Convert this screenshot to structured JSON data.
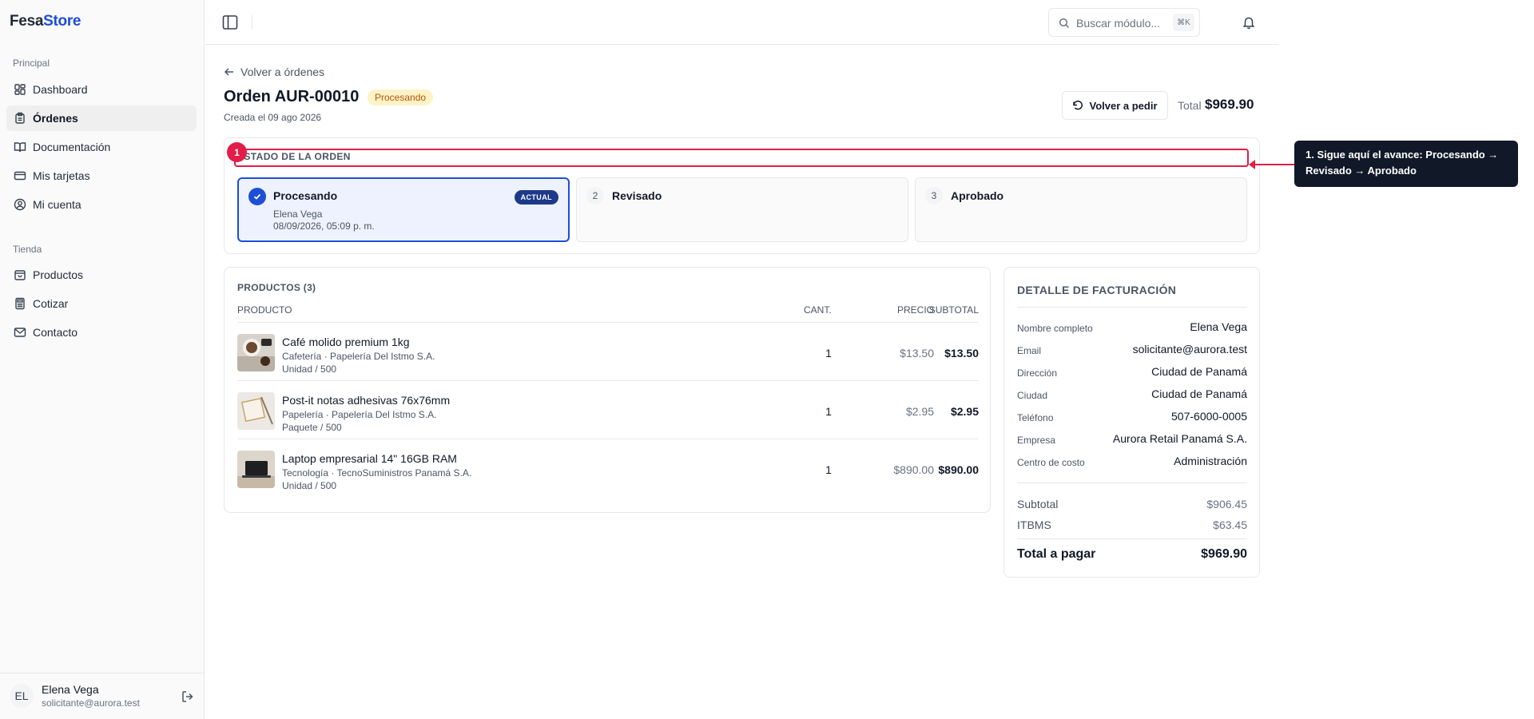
{
  "brand": {
    "part1": "Fesa",
    "part2": "Store"
  },
  "sidebar": {
    "section_principal": "Principal",
    "section_tienda": "Tienda",
    "items": [
      {
        "label": "Dashboard",
        "icon": "dashboard-icon"
      },
      {
        "label": "Órdenes",
        "icon": "clipboard-icon",
        "active": true
      },
      {
        "label": "Documentación",
        "icon": "book-icon"
      },
      {
        "label": "Mis tarjetas",
        "icon": "credit-card-icon"
      },
      {
        "label": "Mi cuenta",
        "icon": "user-circle-icon"
      },
      {
        "label": "Productos",
        "icon": "box-icon"
      },
      {
        "label": "Cotizar",
        "icon": "calculator-icon"
      },
      {
        "label": "Contacto",
        "icon": "mail-icon"
      }
    ],
    "user": {
      "initials": "EL",
      "name": "Elena Vega",
      "email": "solicitante@aurora.test"
    }
  },
  "topbar": {
    "search_placeholder": "Buscar módulo...",
    "shortcut": "⌘K"
  },
  "order": {
    "back_label": "Volver a órdenes",
    "title": "Orden AUR-00010",
    "status": "Procesando",
    "created": "Creada el 09 ago 2026",
    "reorder_label": "Volver a pedir",
    "total_label": "Total",
    "total_value": "$969.90"
  },
  "status_card": {
    "heading": "ESTADO DE LA ORDEN",
    "steps": [
      {
        "label": "Procesando",
        "badge": "ACTUAL",
        "by": "Elena Vega",
        "date": "08/09/2026, 05:09 p. m."
      },
      {
        "number": "2",
        "label": "Revisado"
      },
      {
        "number": "3",
        "label": "Aprobado"
      }
    ]
  },
  "annotation": {
    "number": "1",
    "text": "1. Sigue aquí el avance: Procesando → Revisado → Aprobado",
    "color": "#e11d48"
  },
  "products": {
    "heading": "PRODUCTOS (3)",
    "columns": {
      "product": "PRODUCTO",
      "qty": "CANT.",
      "price": "PRECIO",
      "subtotal": "SUBTOTAL"
    },
    "rows": [
      {
        "name": "Café molido premium 1kg",
        "meta": "Cafetería · Papelería Del Istmo S.A.",
        "unit": "Unidad / 500",
        "qty": "1",
        "price": "$13.50",
        "subtotal": "$13.50"
      },
      {
        "name": "Post-it notas adhesivas 76x76mm",
        "meta": "Papelería · Papelería Del Istmo S.A.",
        "unit": "Paquete / 500",
        "qty": "1",
        "price": "$2.95",
        "subtotal": "$2.95"
      },
      {
        "name": "Laptop empresarial 14\" 16GB RAM",
        "meta": "Tecnología · TecnoSuministros Panamá S.A.",
        "unit": "Unidad / 500",
        "qty": "1",
        "price": "$890.00",
        "subtotal": "$890.00"
      }
    ]
  },
  "billing": {
    "heading": "DETALLE DE FACTURACIÓN",
    "fields": [
      {
        "label": "Nombre completo",
        "value": "Elena Vega"
      },
      {
        "label": "Email",
        "value": "solicitante@aurora.test"
      },
      {
        "label": "Dirección",
        "value": "Ciudad de Panamá"
      },
      {
        "label": "Ciudad",
        "value": "Ciudad de Panamá"
      },
      {
        "label": "Teléfono",
        "value": "507-6000-0005"
      },
      {
        "label": "Empresa",
        "value": "Aurora Retail Panamá S.A."
      },
      {
        "label": "Centro de costo",
        "value": "Administración"
      }
    ],
    "subtotal_label": "Subtotal",
    "subtotal_value": "$906.45",
    "tax_label": "ITBMS",
    "tax_value": "$63.45",
    "total_label": "Total a pagar",
    "total_value": "$969.90"
  },
  "colors": {
    "accent": "#1d4ed8",
    "status_bg": "#fef3c7",
    "status_text": "#b45309",
    "annotation": "#e11d48"
  }
}
